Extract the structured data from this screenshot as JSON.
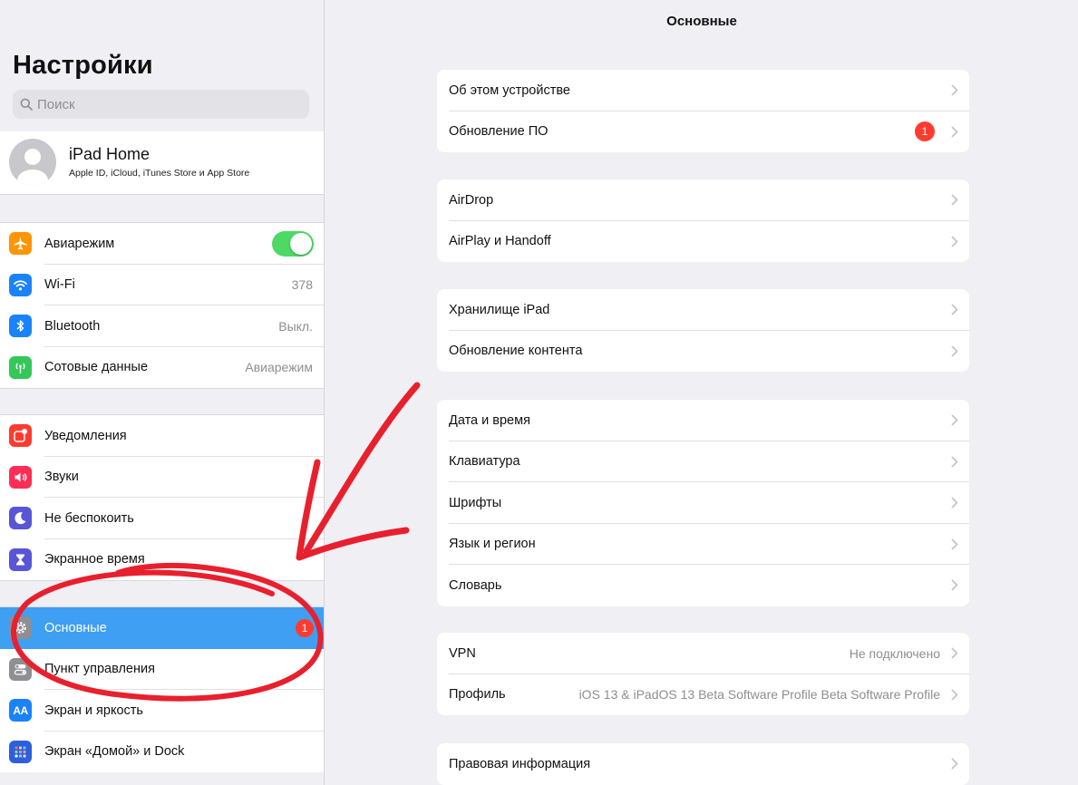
{
  "sidebar": {
    "title": "Настройки",
    "search_placeholder": "Поиск",
    "profile": {
      "name": "iPad Home",
      "subtitle": "Apple ID, iCloud, iTunes Store и App Store"
    },
    "groups": [
      [
        {
          "label": "Авиарежим",
          "icon": "airplane-icon",
          "color": "#ff9500",
          "toggle": true
        },
        {
          "label": "Wi-Fi",
          "icon": "wifi-icon",
          "color": "#1a82fb",
          "value": "378"
        },
        {
          "label": "Bluetooth",
          "icon": "bluetooth-icon",
          "color": "#1a82fb",
          "value": "Выкл."
        },
        {
          "label": "Сотовые данные",
          "icon": "cellular-icon",
          "color": "#34c759",
          "value": "Авиарежим"
        }
      ],
      [
        {
          "label": "Уведомления",
          "icon": "notifications-icon",
          "color": "#ff3b30"
        },
        {
          "label": "Звуки",
          "icon": "sound-icon",
          "color": "#ff2d55"
        },
        {
          "label": "Не беспокоить",
          "icon": "moon-icon",
          "color": "#5856d6"
        },
        {
          "label": "Экранное время",
          "icon": "hourglass-icon",
          "color": "#5856d6"
        }
      ],
      [
        {
          "label": "Основные",
          "icon": "gear-icon",
          "color": "#8e8e93",
          "badge": "1",
          "active": true
        },
        {
          "label": "Пункт управления",
          "icon": "control-center-icon",
          "color": "#8e8e93"
        },
        {
          "label": "Экран и яркость",
          "icon": "display-icon",
          "color": "#1a82fb",
          "icon_text": "AA"
        },
        {
          "label": "Экран «Домой» и Dock",
          "icon": "home-screen-icon",
          "color": "#2c5fdc"
        }
      ]
    ]
  },
  "main": {
    "title": "Основные",
    "groups": [
      [
        {
          "label": "Об этом устройстве"
        },
        {
          "label": "Обновление ПО",
          "badge": "1"
        }
      ],
      [
        {
          "label": "AirDrop"
        },
        {
          "label": "AirPlay и Handoff"
        }
      ],
      [
        {
          "label": "Хранилище iPad"
        },
        {
          "label": "Обновление контента"
        }
      ],
      [
        {
          "label": "Дата и время"
        },
        {
          "label": "Клавиатура"
        },
        {
          "label": "Шрифты"
        },
        {
          "label": "Язык и регион"
        },
        {
          "label": "Словарь"
        }
      ],
      [
        {
          "label": "VPN",
          "value": "Не подключено"
        },
        {
          "label": "Профиль",
          "value": "iOS 13 & iPadOS 13 Beta Software Profile Beta Software Profile"
        }
      ],
      [
        {
          "label": "Правовая информация"
        }
      ]
    ]
  },
  "colors": {
    "accent": "#3f9ff2",
    "toggle_on": "#4cd964",
    "badge": "#ff3b30",
    "annotation": "#e8202e"
  }
}
